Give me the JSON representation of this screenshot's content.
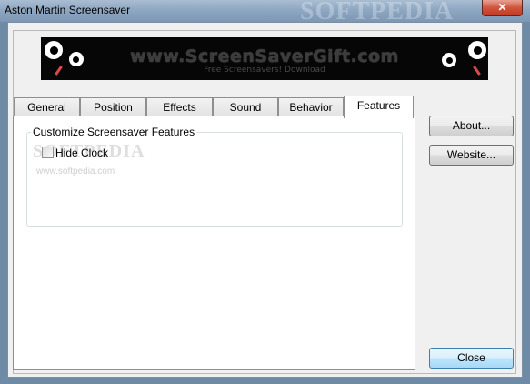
{
  "window": {
    "title": "Aston Martin Screensaver",
    "watermark": "SOFTPEDIA",
    "close_glyph": "✕"
  },
  "banner": {
    "title": "www.ScreenSaverGift.com",
    "subtitle": "Free Screensavers! Download"
  },
  "tabs": [
    {
      "label": "General"
    },
    {
      "label": "Position"
    },
    {
      "label": "Effects"
    },
    {
      "label": "Sound"
    },
    {
      "label": "Behavior"
    },
    {
      "label": "Features"
    }
  ],
  "active_tab": "Features",
  "features": {
    "group_label": "Customize Screensaver Features",
    "hide_clock_label": "Hide Clock",
    "hide_clock_checked": false
  },
  "watermarks": {
    "panel_large": "SOFTPEDIA",
    "panel_small": "www.softpedia.com"
  },
  "buttons": {
    "about": "About...",
    "website": "Website...",
    "close": "Close"
  },
  "colors": {
    "banner_bg": "#060606",
    "default_button_border": "#3c7fb1"
  }
}
